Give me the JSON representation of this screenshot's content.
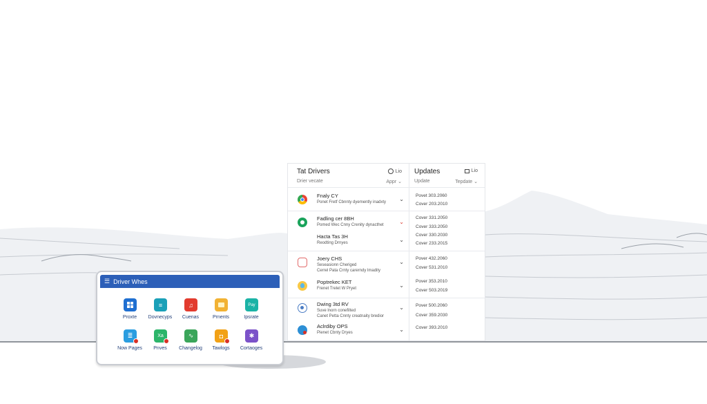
{
  "drivers_panel": {
    "title": "Tat Drivers",
    "header_right": "Lio",
    "subtitle": "Drier vecate",
    "filter": "Appr",
    "items": [
      {
        "name": "Fnaly CY",
        "desc": "Ponet Fretf Cbnnty dyemently inadxty",
        "icon": "chrome-icon",
        "chev": "chevron-down-icon"
      },
      {
        "name": "Fadling cer 8BH",
        "desc": "Pomed Wec Cnny Crenity dynacthet",
        "icon": "green-circle-icon",
        "chev": "chevron-down-red-icon"
      },
      {
        "name": "Hacta Tas 3H",
        "desc": "Reodting Drnyes",
        "icon": "",
        "chev": "chevron-down-icon"
      },
      {
        "name": "Joery CHS",
        "desc": "Seseasionn Cheriged",
        "desc2": "Cerrel Pata Crnty carerndy lmadity",
        "icon": "camera-icon",
        "chev": "chevron-down-icon"
      },
      {
        "name": "Poptrekec KET",
        "desc": "Frenet Trelet W Pryet",
        "icon": "bulb-icon",
        "chev": "chevron-down-icon"
      },
      {
        "name": "Dwing 3td RV",
        "desc": "Suve lnorn conefilted",
        "desc2": "Canet Petta Cnnty creatnaity bredior",
        "icon": "steam-icon",
        "chev": "chevron-down-icon"
      },
      {
        "name": "Aclrdiby OPS",
        "desc": "Pienet Cbnty Dryes",
        "icon": "shield-icon",
        "chev": "chevron-down-icon"
      }
    ]
  },
  "updates_panel": {
    "title": "Updates",
    "header_right": "Lio",
    "subtitle": "Update",
    "filter": "Tepdate",
    "rows": [
      "Povet 303.2060",
      "Cover 203.2010",
      "Cover 331.2050",
      "Cover 333.2050",
      "Cover 330.2030",
      "Cover 233.2015",
      "Pover 432.2060",
      "Cover 531.2010",
      "Pover 353.2010",
      "Cover 503.2019",
      "Pover 500.2060",
      "Cover 359.2030",
      "Cover 393.2010"
    ]
  },
  "driver_window": {
    "title": "Driver Whes",
    "apps": [
      {
        "label": "Proxte",
        "icon": "windows-icon",
        "color": "#1f6fd1",
        "badge": false
      },
      {
        "label": "Dovnecyps",
        "icon": "list-icon",
        "color": "#1aa0b8",
        "badge": false
      },
      {
        "label": "Cuenas",
        "icon": "music-icon",
        "color": "#e23b2e",
        "badge": false
      },
      {
        "label": "Prnents",
        "icon": "folder-icon",
        "color": "#f2b233",
        "badge": false
      },
      {
        "label": "Ipsrate",
        "icon": "pay-icon",
        "color": "#1bb3a6",
        "badge": false,
        "glyph": "Pay"
      },
      {
        "label": "Now Pages",
        "icon": "doc-icon",
        "color": "#2a9de0",
        "badge": true
      },
      {
        "label": "Pnves",
        "icon": "xa-icon",
        "color": "#2cb56a",
        "badge": true,
        "glyph": "Xa"
      },
      {
        "label": "Changelog",
        "icon": "chart-icon",
        "color": "#3aa55a",
        "badge": false
      },
      {
        "label": "Tawlogs",
        "icon": "tag-icon",
        "color": "#f2a116",
        "badge": true
      },
      {
        "label": "Cortaoges",
        "icon": "puzzle-icon",
        "color": "#7b52c9",
        "badge": false
      }
    ]
  }
}
